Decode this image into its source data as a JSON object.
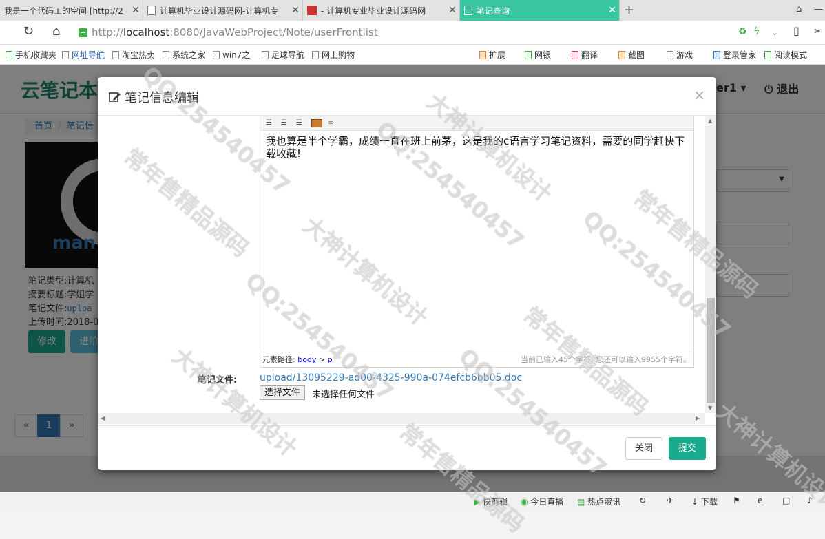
{
  "browser": {
    "tabs": [
      {
        "title": "我是一个代码工的空间 [http://2"
      },
      {
        "title": "计算机毕业设计源码网-计算机专"
      },
      {
        "title": "- 计算机专业毕业设计源码网"
      },
      {
        "title": "笔记查询"
      }
    ],
    "url_host": "localhost",
    "url_rest": ":8080/JavaWebProject/Note/userFrontlist",
    "url_scheme": "http://",
    "bookmarks": [
      "手机收藏夹",
      "网址导航",
      "淘宝热卖",
      "系统之家",
      "win7之",
      "足球导航",
      "网上购物"
    ],
    "tools": [
      "扩展",
      "网银",
      "翻译",
      "截图",
      "游戏",
      "登录管家",
      "阅读模式"
    ]
  },
  "page": {
    "logo": "云笔记本",
    "user": "er1",
    "logout": "退出",
    "breadcrumb_home": "首页",
    "breadcrumb_sep": "/",
    "breadcrumb_current": "笔记信",
    "thumb_text": "man",
    "meta": {
      "type_label": "笔记类型:计算机",
      "title_label": "摘要标题:学姐学",
      "file_label": "笔记文件:",
      "file_value": "uploa",
      "time_label": "上传时间:2018-0"
    },
    "edit_button": "修改",
    "other_button": "进阶",
    "pager_prev": "«",
    "pager_current": "1",
    "pager_next": "»"
  },
  "modal": {
    "title": "笔记信息编辑",
    "close_symbol": "×",
    "editor_content": "我也算是半个学霸，成绩一直在班上前茅，这是我的c语言学习笔记资料，需要的同学赶快下载收藏!",
    "path_label": "元素路径:",
    "path_body": "body",
    "path_sep": ">",
    "path_p": "p",
    "char_count": "当前已输入45个字符, 您还可以输入9955个字符。",
    "file_label": "笔记文件:",
    "file_link": "upload/13095229-ad00-4325-990a-074efcb6bb05.doc",
    "choose_button": "选择文件",
    "no_file": "未选择任何文件",
    "close_button": "关闭",
    "submit_button": "提交"
  },
  "statusbar": [
    "快剪辑",
    "今日直播",
    "热点资讯",
    "下载"
  ],
  "watermark": [
    "QQ:254540457",
    "大神计算机设计",
    "常年售精品源码"
  ],
  "colors": {
    "accent": "#1aaa8c",
    "active_tab": "#37c6a0",
    "link": "#337ab7"
  }
}
